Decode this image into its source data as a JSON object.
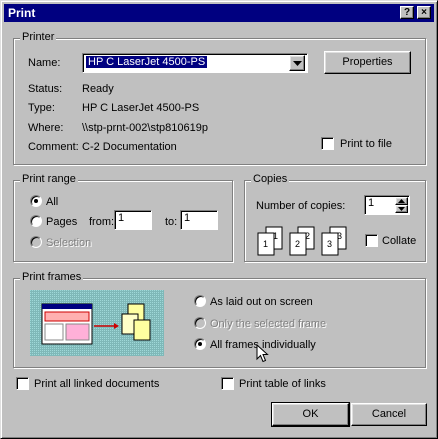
{
  "window": {
    "title": "Print",
    "help_label": "?",
    "close_label": "×"
  },
  "printer": {
    "group_label": "Printer",
    "name_label": "Name:",
    "name_value": "HP C LaserJet 4500-PS",
    "properties_label": "Properties",
    "status_label": "Status:",
    "status_value": "Ready",
    "type_label": "Type:",
    "type_value": "HP C LaserJet 4500-PS",
    "where_label": "Where:",
    "where_value": "\\\\stp-prnt-002\\stp810619p",
    "comment_label": "Comment:",
    "comment_value": "C-2 Documentation",
    "print_to_file_label": "Print to file"
  },
  "print_range": {
    "group_label": "Print range",
    "all_label": "All",
    "pages_label": "Pages",
    "from_label": "from:",
    "from_value": "1",
    "to_label": "to:",
    "to_value": "1",
    "selection_label": "Selection"
  },
  "copies": {
    "group_label": "Copies",
    "number_label": "Number of copies:",
    "number_value": "1",
    "collate_label": "Collate",
    "icon_pages": [
      "1",
      "1",
      "2",
      "2",
      "3",
      "3"
    ]
  },
  "print_frames": {
    "group_label": "Print frames",
    "option_layout": "As laid out on screen",
    "option_selected": "Only the selected frame",
    "option_individual": "All frames individually"
  },
  "options": {
    "linked_docs_label": "Print all linked documents",
    "table_links_label": "Print table of links"
  },
  "buttons": {
    "ok_label": "OK",
    "cancel_label": "Cancel"
  }
}
